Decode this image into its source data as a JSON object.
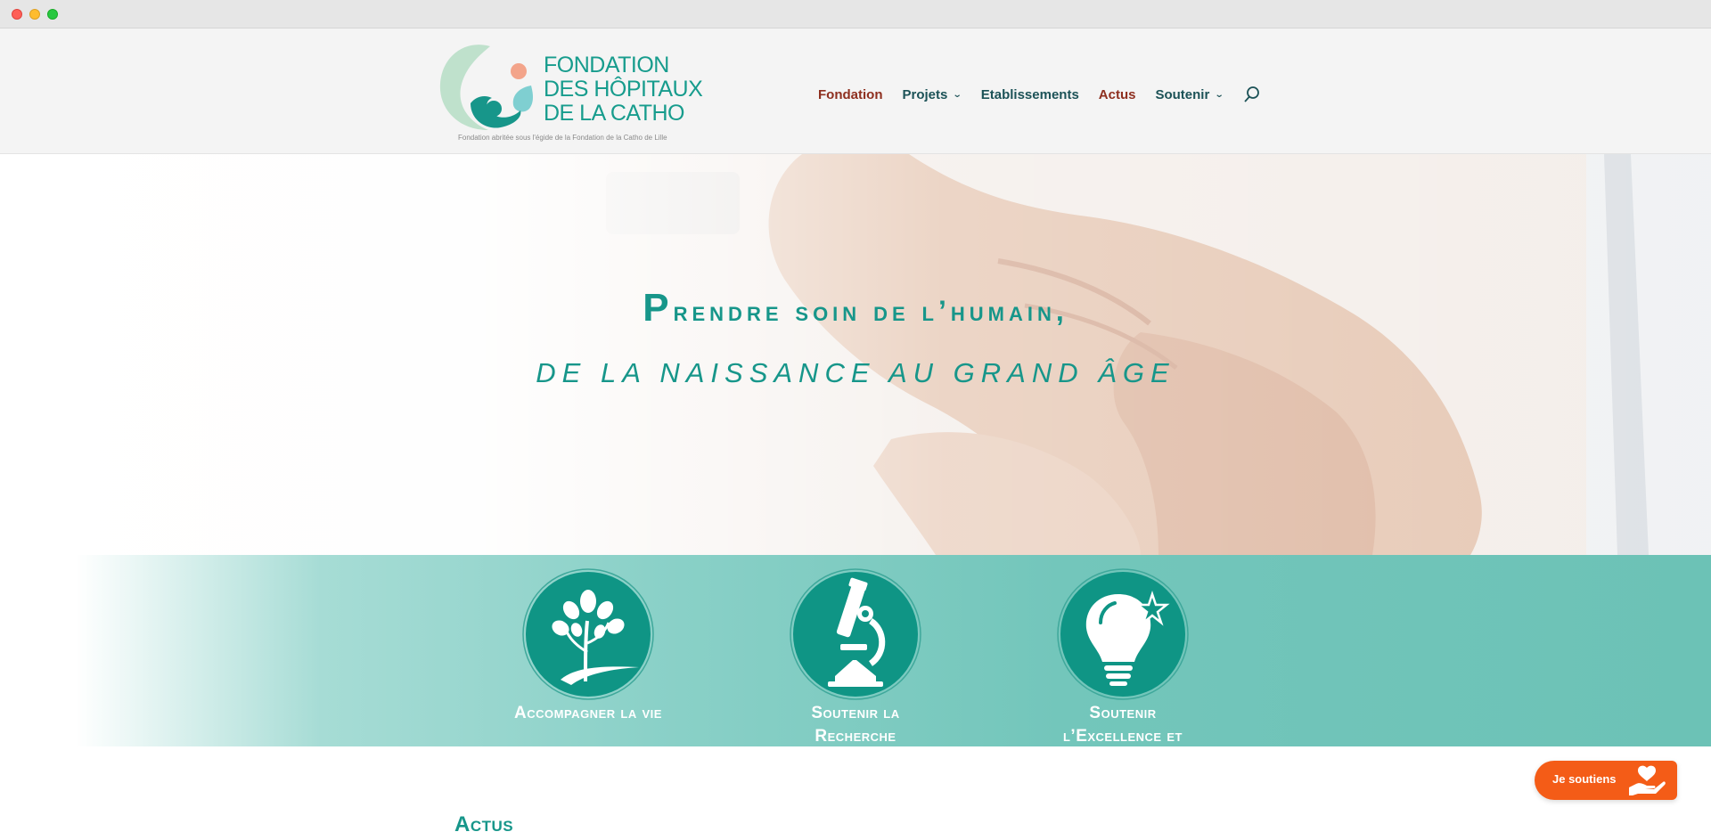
{
  "browser": {
    "controls": [
      "close",
      "minimize",
      "maximize"
    ]
  },
  "header": {
    "logo": {
      "line1": "FONDATION",
      "line2": "DES HÔPITAUX",
      "line3": "DE LA CATHO",
      "caption": "Fondation abritée sous l'égide de la Fondation de la Catho de Lille"
    },
    "nav": [
      {
        "label": "Fondation",
        "active": true,
        "dropdown": false
      },
      {
        "label": "Projets",
        "active": false,
        "dropdown": true
      },
      {
        "label": "Etablissements",
        "active": false,
        "dropdown": false
      },
      {
        "label": "Actus",
        "active": true,
        "dropdown": false
      },
      {
        "label": "Soutenir",
        "active": false,
        "dropdown": true
      }
    ],
    "search_icon": "search-icon"
  },
  "hero": {
    "first_letter": "P",
    "line1_rest": "rendre soin de l’humain,",
    "line2": "DE LA NAISSANCE AU GRAND ÂGE"
  },
  "pillars": [
    {
      "icon": "tree-icon",
      "label_line1": "Accompagner la vie",
      "label_line2": ""
    },
    {
      "icon": "microscope-icon",
      "label_line1": "Soutenir la",
      "label_line2": "Recherche"
    },
    {
      "icon": "lightbulb-star-icon",
      "label_line1": "Soutenir",
      "label_line2": "l’Excellence et"
    }
  ],
  "actus": {
    "title": "Actus"
  },
  "donate": {
    "label": "Je soutiens",
    "icon": "heart-hand-icon"
  },
  "colors": {
    "brand_teal": "#17968a",
    "nav_text": "#1c5257",
    "nav_active": "#8e2f1f",
    "donate_orange": "#f45c17",
    "band_teal": "#6cc2b6"
  }
}
